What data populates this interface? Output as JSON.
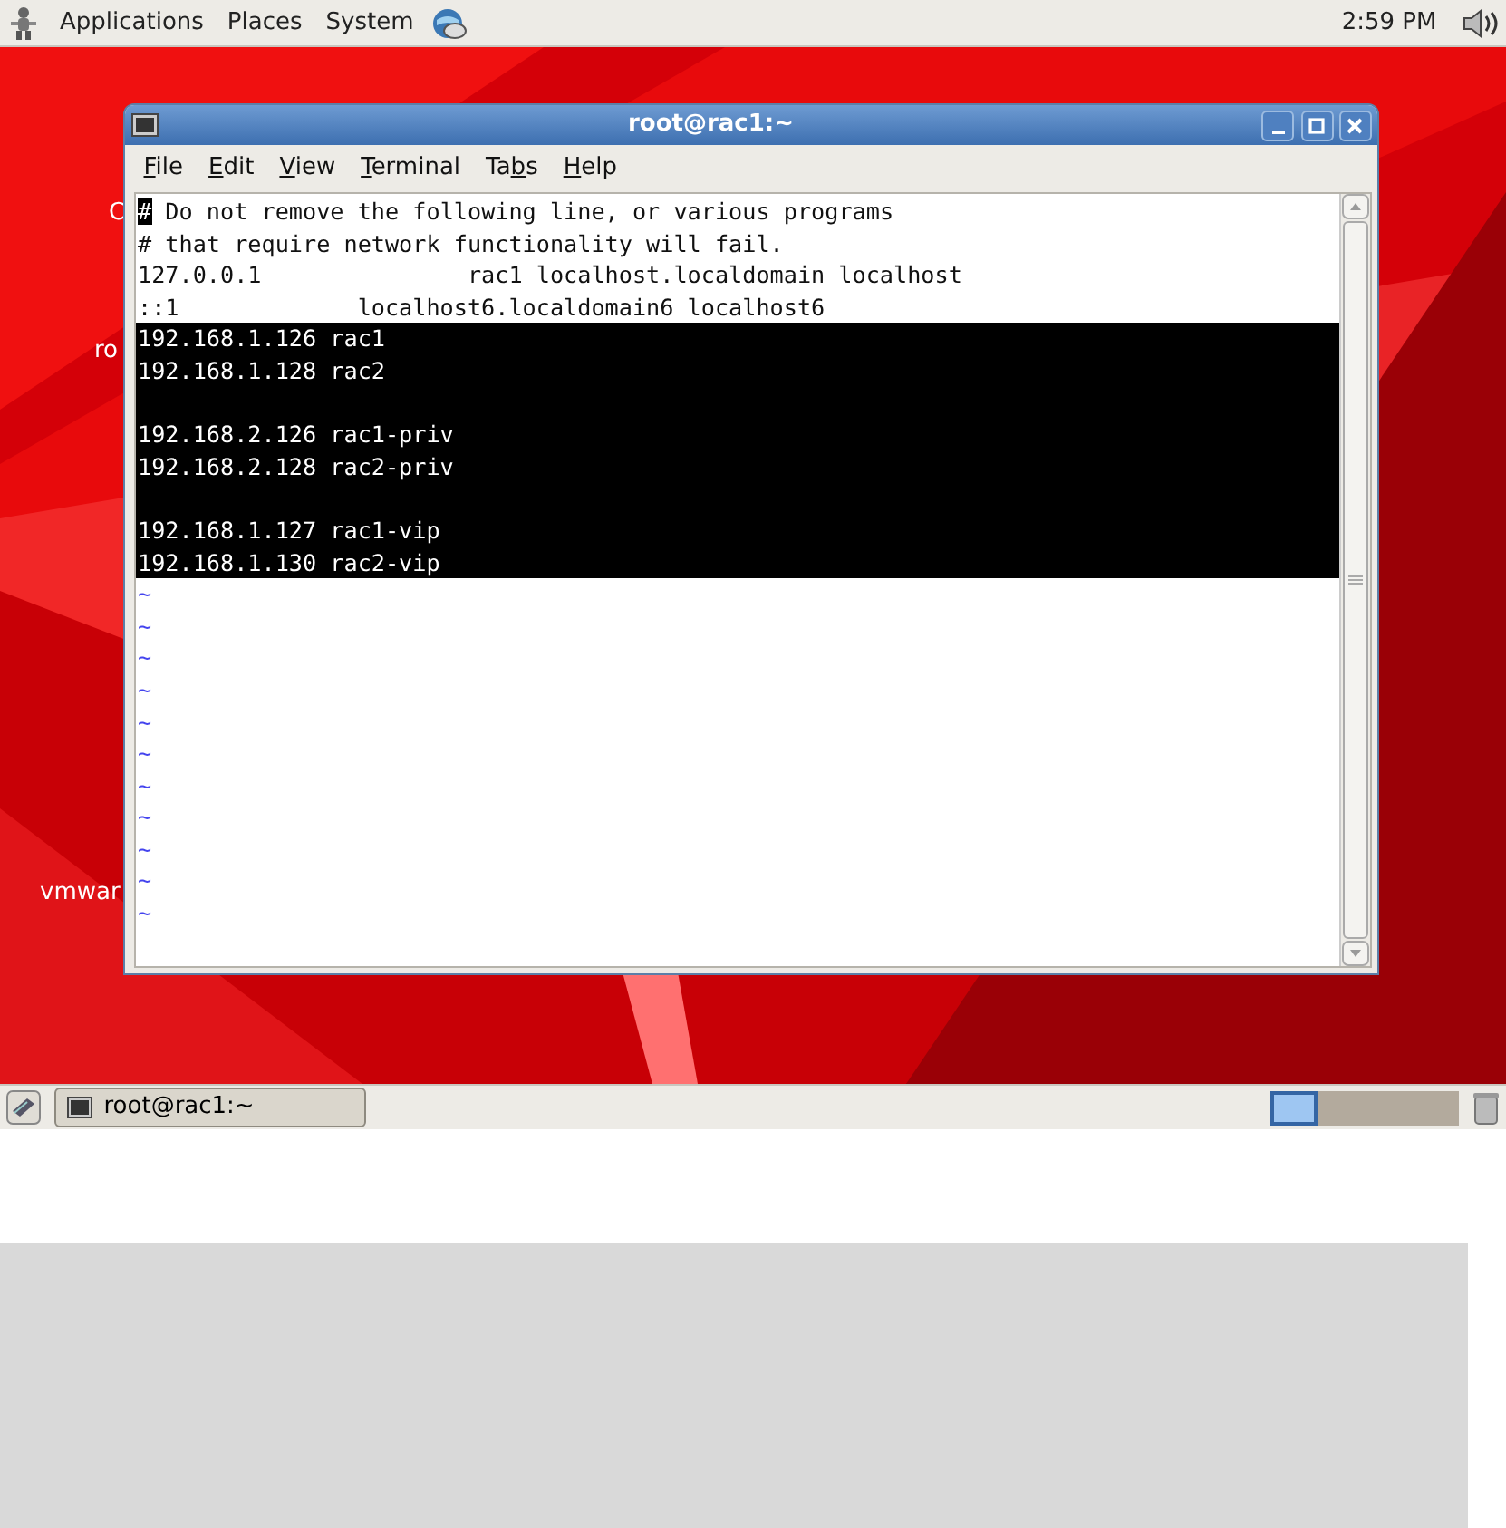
{
  "top_panel": {
    "menus": [
      "Applications",
      "Places",
      "System"
    ],
    "clock": "2:59 PM"
  },
  "desktop_labels": [
    "C",
    "ro",
    "vmwar"
  ],
  "window": {
    "title": "root@rac1:~",
    "menus": [
      {
        "key": "F",
        "after": "ile"
      },
      {
        "key": "E",
        "after": "dit"
      },
      {
        "key": "V",
        "after": "iew"
      },
      {
        "key": "T",
        "after": "erminal"
      },
      {
        "before": "Ta",
        "key": "b",
        "after": "s"
      },
      {
        "key": "H",
        "after": "elp"
      }
    ],
    "lines": [
      {
        "kind": "text",
        "text": "# Do not remove the following line, or various programs",
        "selected": false,
        "cursor": true
      },
      {
        "kind": "text",
        "text": "# that require network functionality will fail.",
        "selected": false,
        "cursor": false
      },
      {
        "kind": "text",
        "text": "127.0.0.1               rac1 localhost.localdomain localhost",
        "selected": false,
        "cursor": false
      },
      {
        "kind": "text",
        "text": "::1             localhost6.localdomain6 localhost6",
        "selected": false,
        "cursor": false
      },
      {
        "kind": "text",
        "text": "192.168.1.126 rac1",
        "selected": true,
        "cursor": false
      },
      {
        "kind": "text",
        "text": "192.168.1.128 rac2",
        "selected": true,
        "cursor": false
      },
      {
        "kind": "blank",
        "selected": true,
        "cursor": false
      },
      {
        "kind": "text",
        "text": "192.168.2.126 rac1-priv",
        "selected": true,
        "cursor": false
      },
      {
        "kind": "text",
        "text": "192.168.2.128 rac2-priv",
        "selected": true,
        "cursor": false
      },
      {
        "kind": "blank",
        "selected": true,
        "cursor": false
      },
      {
        "kind": "text",
        "text": "192.168.1.127 rac1-vip",
        "selected": true,
        "cursor": false
      },
      {
        "kind": "text",
        "text": "192.168.1.130 rac2-vip",
        "selected": true,
        "cursor": false
      },
      {
        "kind": "tilde",
        "text": "~",
        "selected": false,
        "cursor": false
      },
      {
        "kind": "tilde",
        "text": "~",
        "selected": false,
        "cursor": false
      },
      {
        "kind": "tilde",
        "text": "~",
        "selected": false,
        "cursor": false
      },
      {
        "kind": "tilde",
        "text": "~",
        "selected": false,
        "cursor": false
      },
      {
        "kind": "tilde",
        "text": "~",
        "selected": false,
        "cursor": false
      },
      {
        "kind": "tilde",
        "text": "~",
        "selected": false,
        "cursor": false
      },
      {
        "kind": "tilde",
        "text": "~",
        "selected": false,
        "cursor": false
      },
      {
        "kind": "tilde",
        "text": "~",
        "selected": false,
        "cursor": false
      },
      {
        "kind": "tilde",
        "text": "~",
        "selected": false,
        "cursor": false
      },
      {
        "kind": "tilde",
        "text": "~",
        "selected": false,
        "cursor": false
      },
      {
        "kind": "tilde",
        "text": "~",
        "selected": false,
        "cursor": false
      }
    ]
  },
  "bottom_panel": {
    "task": "root@rac1:~",
    "workspaces": [
      {
        "selected": true
      },
      {
        "selected": false
      },
      {
        "selected": false
      },
      {
        "selected": false
      }
    ]
  }
}
